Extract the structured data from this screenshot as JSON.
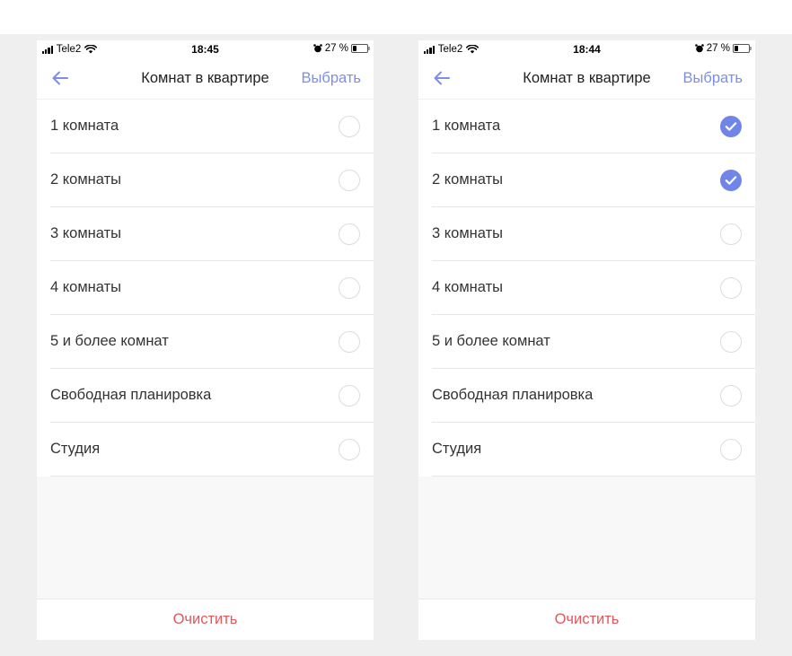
{
  "colors": {
    "accent": "#7d8ee6",
    "check_fill": "#7185e8",
    "danger": "#e3565b",
    "page_background": "#efefef",
    "screen_background": "#f8f8f8"
  },
  "screens": [
    {
      "status_bar": {
        "carrier": "Tele2",
        "time": "18:45",
        "battery": "27 %",
        "icons": [
          "signal-icon",
          "wifi-icon",
          "alarm-icon",
          "battery-icon"
        ]
      },
      "nav": {
        "back_icon": "arrow-left-icon",
        "title": "Комнат в квартире",
        "action": "Выбрать"
      },
      "options": [
        {
          "label": "1 комната",
          "checked": false
        },
        {
          "label": "2 комнаты",
          "checked": false
        },
        {
          "label": "3 комнаты",
          "checked": false
        },
        {
          "label": "4 комнаты",
          "checked": false
        },
        {
          "label": "5 и более комнат",
          "checked": false
        },
        {
          "label": "Свободная планировка",
          "checked": false
        },
        {
          "label": "Студия",
          "checked": false
        }
      ],
      "footer": {
        "clear_label": "Очистить"
      }
    },
    {
      "status_bar": {
        "carrier": "Tele2",
        "time": "18:44",
        "battery": "27 %",
        "icons": [
          "signal-icon",
          "wifi-icon",
          "alarm-icon",
          "battery-icon"
        ]
      },
      "nav": {
        "back_icon": "arrow-left-icon",
        "title": "Комнат в квартире",
        "action": "Выбрать"
      },
      "options": [
        {
          "label": "1 комната",
          "checked": true
        },
        {
          "label": "2 комнаты",
          "checked": true
        },
        {
          "label": "3 комнаты",
          "checked": false
        },
        {
          "label": "4 комнаты",
          "checked": false
        },
        {
          "label": "5 и более комнат",
          "checked": false
        },
        {
          "label": "Свободная планировка",
          "checked": false
        },
        {
          "label": "Студия",
          "checked": false
        }
      ],
      "footer": {
        "clear_label": "Очистить"
      }
    }
  ]
}
